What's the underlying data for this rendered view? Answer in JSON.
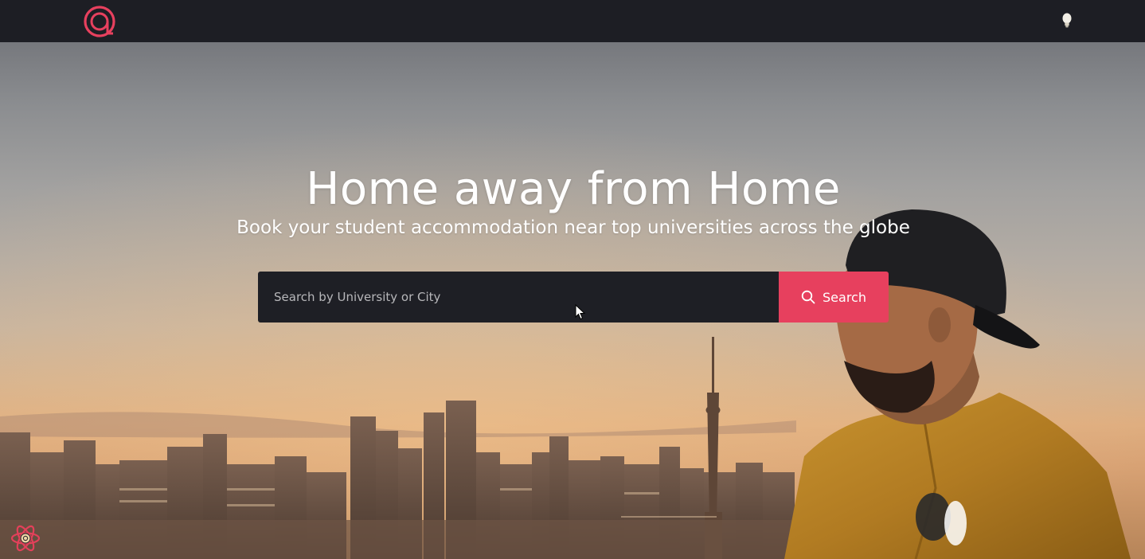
{
  "navbar": {
    "logo_icon": "at-sign-logo-icon",
    "theme_toggle_icon": "lightbulb-icon"
  },
  "hero": {
    "title": "Home away from Home",
    "subtitle": "Book your student accommodation near top universities across the globe"
  },
  "search": {
    "placeholder": "Search by University or City",
    "value": "",
    "button_label": "Search",
    "button_icon": "search-icon"
  },
  "dev_tools": {
    "icon": "react-devtools-icon"
  },
  "colors": {
    "navbar_bg": "#1d1e24",
    "accent": "#e7405e",
    "search_bg": "#1e1f25",
    "text": "#ffffff"
  }
}
